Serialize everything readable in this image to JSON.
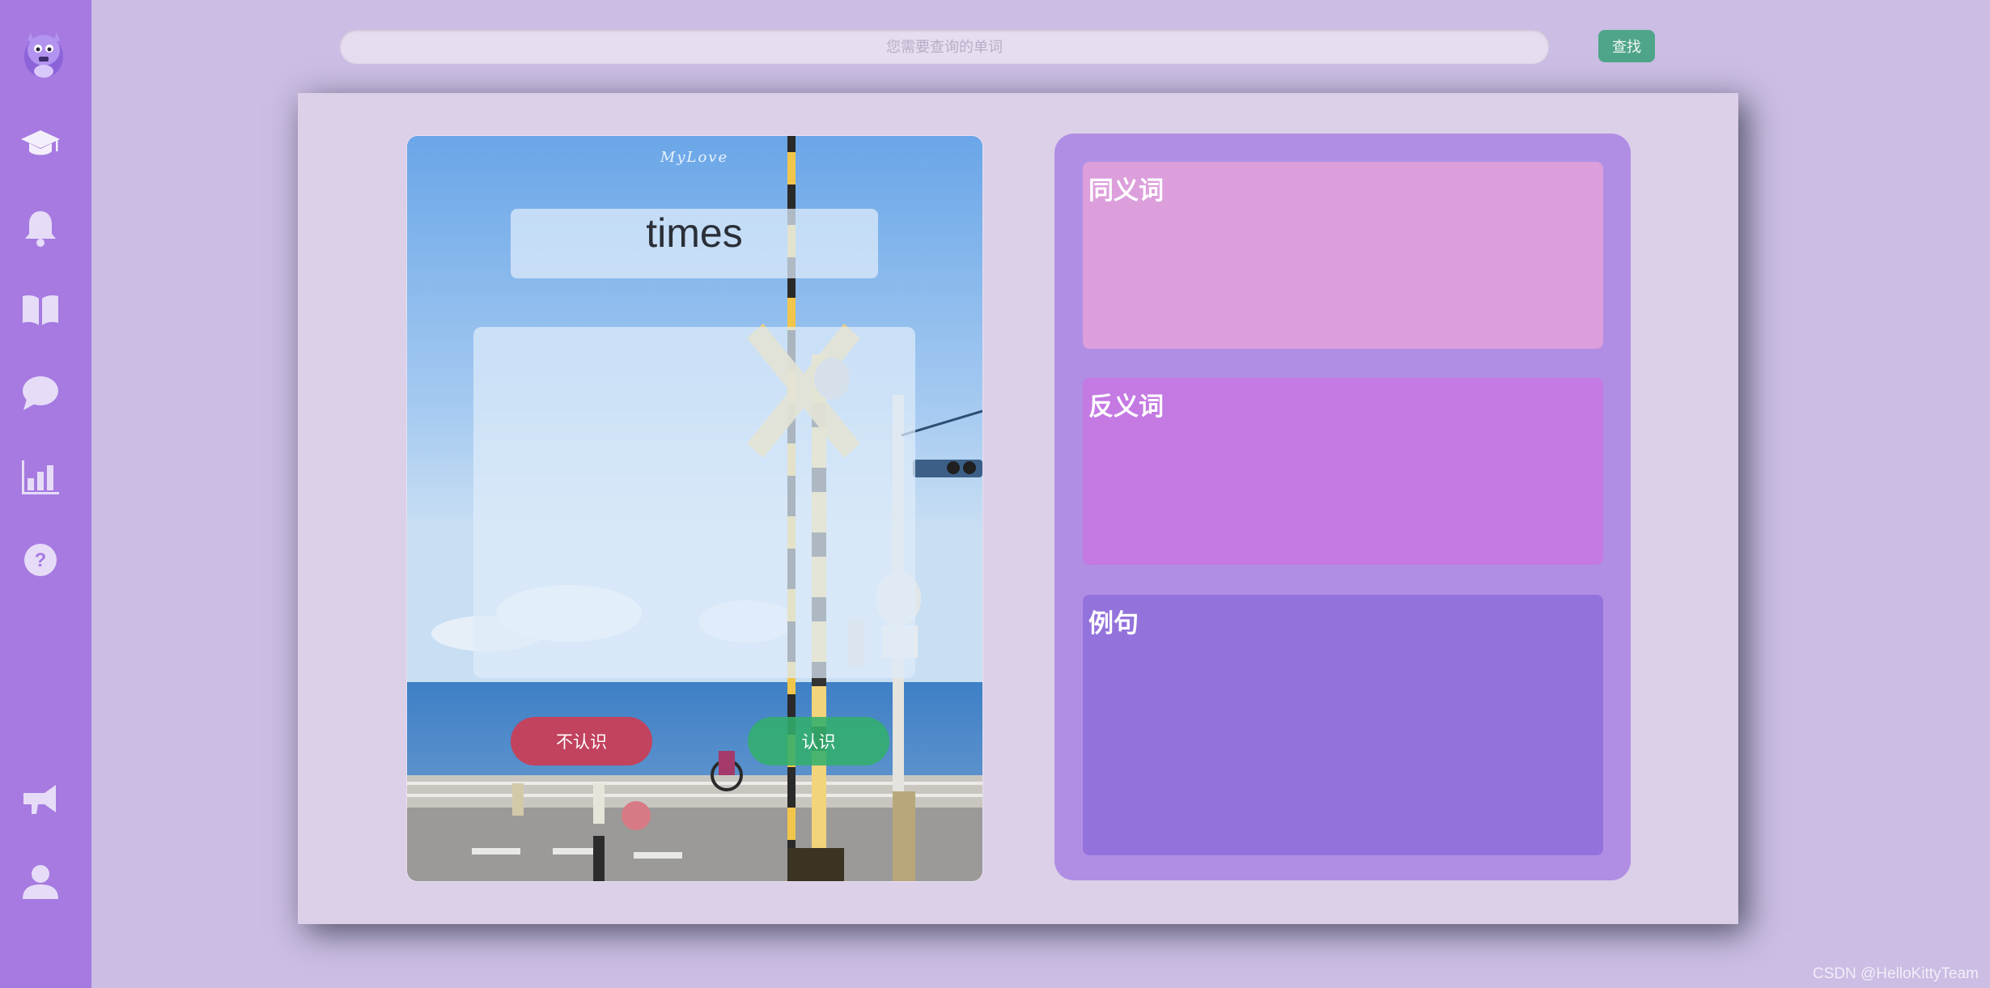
{
  "search": {
    "placeholder": "您需要查询的单词",
    "button_label": "查找"
  },
  "card": {
    "brand_text": "MyLove",
    "word": "times",
    "unknown_label": "不认识",
    "known_label": "认识"
  },
  "details": {
    "synonyms_title": "同义词",
    "antonyms_title": "反义词",
    "examples_title": "例句"
  },
  "footer": {
    "watermark": "CSDN @HelloKittyTeam"
  },
  "sidebar": {
    "icons": [
      "mascot-logo",
      "graduation-cap-icon",
      "bell-icon",
      "book-icon",
      "chat-bubble-icon",
      "bar-chart-icon",
      "question-circle-icon",
      "megaphone-icon",
      "user-icon"
    ]
  },
  "colors": {
    "sidebar": "#a67ae0",
    "search_button": "#4fa58a",
    "unknown_button": "#c2435e",
    "known_button": "#32af6c",
    "synonyms_card": "#dc9fdc",
    "antonyms_card": "#c479e3",
    "examples_card": "#9472dc"
  }
}
